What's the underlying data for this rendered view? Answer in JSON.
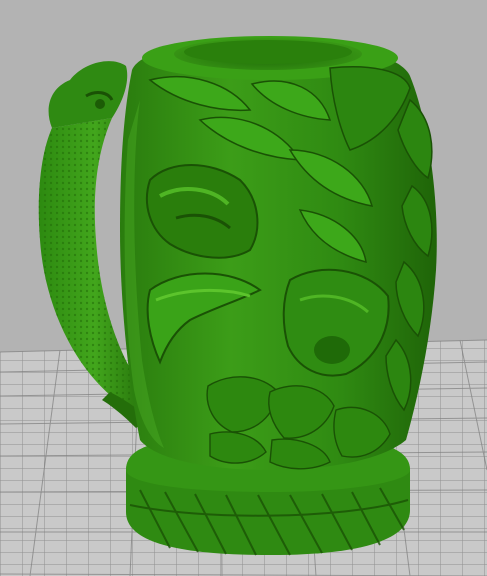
{
  "viewport": {
    "background_color": "#b3b3b3",
    "bed_color": "#c9c9c9",
    "bed_grid_color": "#8a8a8a",
    "model_color": "#2f8a12",
    "model_highlight": "#4fb524",
    "model_shadow": "#1c5c06",
    "model": {
      "name": "dragon-tankard-model",
      "type": "3d-print-preview"
    }
  }
}
